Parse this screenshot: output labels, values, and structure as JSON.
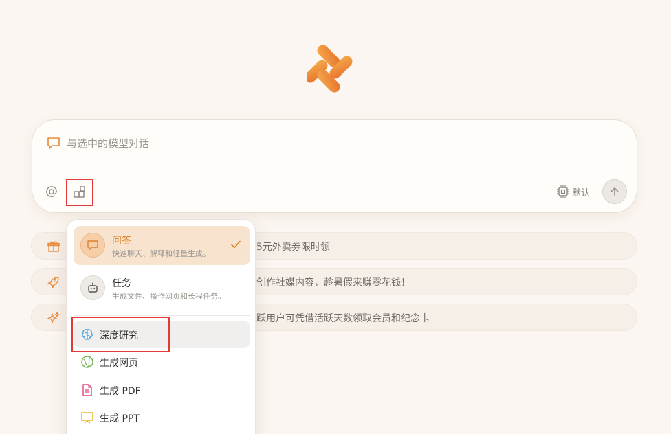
{
  "input": {
    "placeholder": "与选中的模型对话",
    "at_symbol": "@",
    "model_label": "默认"
  },
  "promos": [
    {
      "icon": "gift-icon",
      "text": "5元外卖券限时领"
    },
    {
      "icon": "rocket-icon",
      "text": "创作社媒内容，趁暑假来赚零花钱！"
    },
    {
      "icon": "sparkle-icon",
      "text": "跃用户可凭借活跃天数领取会员和纪念卡"
    }
  ],
  "menu": {
    "modes": [
      {
        "title": "问答",
        "subtitle": "快速聊天、解释和轻量生成。",
        "selected": true
      },
      {
        "title": "任务",
        "subtitle": "生成文件、操作网页和长程任务。",
        "selected": false
      }
    ],
    "tools": [
      {
        "label": "深度研究",
        "icon": "brain-icon",
        "color": "#4aa3df"
      },
      {
        "label": "生成网页",
        "icon": "globe-icon",
        "color": "#6db34a"
      },
      {
        "label": "生成 PDF",
        "icon": "pdf-file-icon",
        "color": "#e0457a"
      },
      {
        "label": "生成 PPT",
        "icon": "presentation-icon",
        "color": "#e8b21a"
      }
    ]
  },
  "colors": {
    "accent": "#e8893a",
    "highlight": "#e53935",
    "background": "#fbf6f1"
  }
}
